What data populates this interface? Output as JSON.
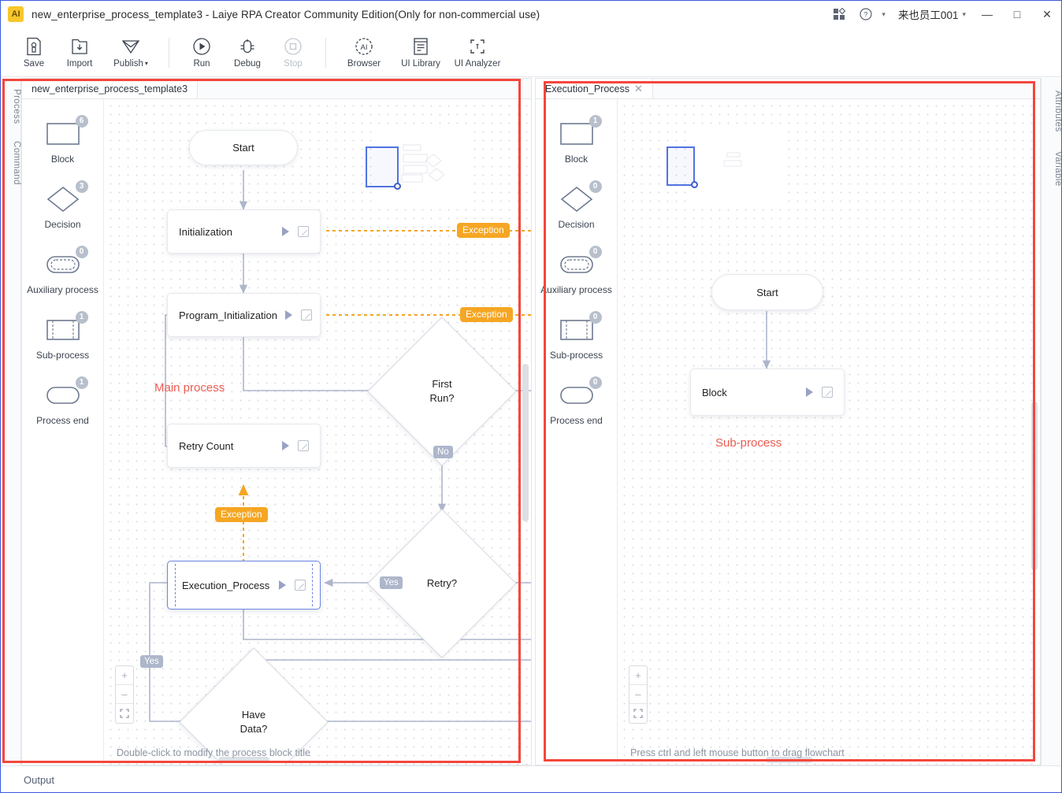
{
  "window": {
    "title": "new_enterprise_process_template3 - Laiye RPA Creator Community Edition(Only for non-commercial use)",
    "logo_text": "AI",
    "user": "来也员工001",
    "minimize": "—",
    "maximize": "□",
    "close": "✕"
  },
  "toolbar": {
    "items": [
      {
        "label": "Save",
        "icon": "save-icon"
      },
      {
        "label": "Import",
        "icon": "import-icon"
      },
      {
        "label": "Publish",
        "icon": "publish-icon",
        "dropdown": "▾"
      },
      {
        "label": "Run",
        "icon": "run-icon"
      },
      {
        "label": "Debug",
        "icon": "debug-icon"
      },
      {
        "label": "Stop",
        "icon": "stop-icon",
        "disabled": true
      },
      {
        "label": "Browser",
        "icon": "browser-ai-icon"
      },
      {
        "label": "UI Library",
        "icon": "ui-library-icon"
      },
      {
        "label": "UI Analyzer",
        "icon": "ui-analyzer-icon"
      }
    ]
  },
  "left_rail": {
    "tabs": [
      "Process",
      "Command"
    ]
  },
  "right_rail": {
    "tabs": [
      "Attributes",
      "Variable"
    ]
  },
  "main_pane": {
    "tab": {
      "label": "new_enterprise_process_template3"
    },
    "palette": [
      {
        "label": "Block",
        "count": "6",
        "shape": "rect"
      },
      {
        "label": "Decision",
        "count": "3",
        "shape": "diamond"
      },
      {
        "label": "Auxiliary process",
        "count": "0",
        "shape": "stadium-dashed"
      },
      {
        "label": "Sub-process",
        "count": "1",
        "shape": "rect-bars"
      },
      {
        "label": "Process end",
        "count": "1",
        "shape": "stadium"
      }
    ],
    "hint": "Double-click to modify the process block title",
    "region_label": "Main process",
    "zoom_controls": {
      "in": "+",
      "out": "–",
      "fit": "fit-icon"
    },
    "nodes": [
      {
        "id": "start",
        "type": "start",
        "label": "Start"
      },
      {
        "id": "init",
        "type": "block",
        "label": "Initialization"
      },
      {
        "id": "proginit",
        "type": "block",
        "label": "Program_Initialization"
      },
      {
        "id": "retrycnt",
        "type": "block",
        "label": "Retry Count"
      },
      {
        "id": "execproc",
        "type": "subprocess",
        "label": "Execution_Process",
        "selected": true
      },
      {
        "id": "firstrun",
        "type": "decision",
        "label_line1": "First",
        "label_line2": "Run?"
      },
      {
        "id": "retry",
        "type": "decision",
        "label_line1": "Retry?",
        "label_line2": ""
      },
      {
        "id": "havedata",
        "type": "decision",
        "label_line1": "Have",
        "label_line2": "Data?"
      }
    ],
    "edge_labels": [
      {
        "text": "No"
      },
      {
        "text": "Yes"
      },
      {
        "text": "Yes"
      }
    ],
    "exception_labels": [
      {
        "text": "Exception"
      },
      {
        "text": "Exception"
      },
      {
        "text": "Exception"
      }
    ]
  },
  "sub_pane": {
    "tab": {
      "label": "Execution_Process",
      "close": "✕"
    },
    "palette": [
      {
        "label": "Block",
        "count": "1",
        "shape": "rect"
      },
      {
        "label": "Decision",
        "count": "0",
        "shape": "diamond"
      },
      {
        "label": "Auxiliary process",
        "count": "0",
        "shape": "stadium-dashed"
      },
      {
        "label": "Sub-process",
        "count": "0",
        "shape": "rect-bars"
      },
      {
        "label": "Process end",
        "count": "0",
        "shape": "stadium"
      }
    ],
    "hint": "Press ctrl and left mouse button to drag flowchart",
    "region_label": "Sub-process",
    "zoom_controls": {
      "in": "+",
      "out": "–",
      "fit": "fit-icon"
    },
    "nodes": [
      {
        "id": "s-start",
        "type": "start",
        "label": "Start"
      },
      {
        "id": "s-block",
        "type": "block",
        "label": "Block"
      }
    ]
  },
  "output": {
    "label": "Output"
  },
  "colors": {
    "accent_blue": "#4a6ee0",
    "exception_orange": "#f5a623",
    "annotation_red": "#f4463c",
    "region_red": "#ec5c52",
    "edge_gray": "#aeb6cb",
    "badge_gray": "#b8bfcc"
  }
}
